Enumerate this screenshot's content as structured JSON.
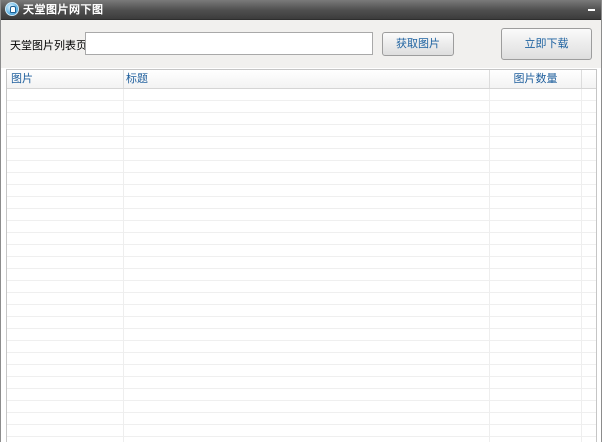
{
  "window": {
    "title": "天堂图片网下图"
  },
  "toolbar": {
    "url_label": "天堂图片列表页：",
    "url_input_value": "",
    "url_input_placeholder": "",
    "fetch_button_label": "获取图片",
    "download_button_label": "立即下载"
  },
  "table": {
    "columns": [
      {
        "label": "图片"
      },
      {
        "label": "标题"
      },
      {
        "label": "图片数量"
      }
    ],
    "rows": []
  },
  "icons": {
    "app": "app-logo-icon",
    "minimize": "minimize-icon"
  },
  "colors": {
    "titlebar": "#4e4e4e",
    "panel": "#f1f0ee",
    "header_text": "#1f5f9d",
    "button_text": "#1f63a1"
  }
}
